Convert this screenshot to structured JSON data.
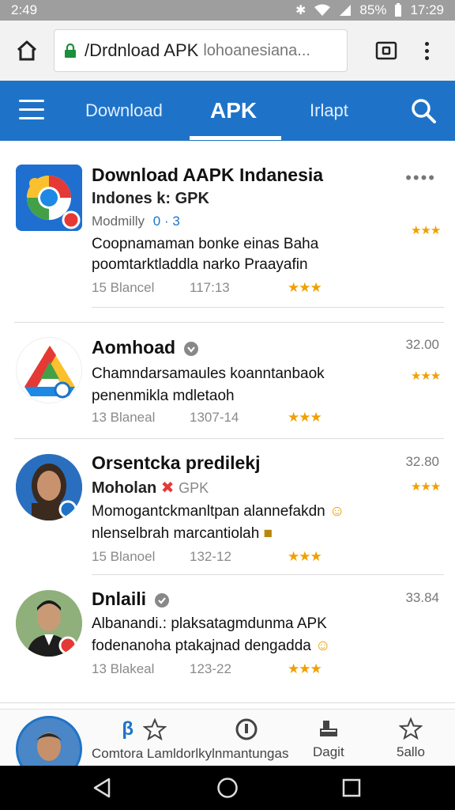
{
  "status_bar": {
    "time_left": "2:49",
    "battery": "85%",
    "time_right": "17:29"
  },
  "browser": {
    "url_main": "/Drdnload APK",
    "url_rest": "lohoanesiana...",
    "home_icon": "home-icon",
    "lock_icon": "lock-icon",
    "tabs_icon": "tabs-icon",
    "menu_icon": "overflow-menu-icon"
  },
  "nav": {
    "tabs": [
      "Download",
      "APK",
      "Irlapt"
    ],
    "active_tab": "APK",
    "menu_icon": "hamburger-icon",
    "search_icon": "search-icon",
    "color": "#1e73c8"
  },
  "items": [
    {
      "title": "Download AAPK Indanesia",
      "sub": "Indones k: GPK",
      "sub2": "Modmilly",
      "sub2_extra": "0 · 3",
      "desc1": "Coopnamaman bonke einas Baha",
      "desc2": "poomtarktladdla narko Praayafin",
      "meta_label": "15 Blancel",
      "meta_num": "117:13",
      "more": "••••"
    },
    {
      "title": "Aomhoad",
      "price": "32.00",
      "desc1": "Chamndarsamaules koanntanbaok",
      "desc2": "penenmikla mdletaoh",
      "meta_label": "13 Blaneal",
      "meta_num": "1307-14"
    },
    {
      "title": "Orsentcka predilekj",
      "sub": "Moholan",
      "sub_extra": "GPK",
      "price": "32.80",
      "desc1": "Momogantckmanltpan alannefakdn",
      "desc2": "nlenselbrah marcantiolah",
      "meta_label": "15 Blanoel",
      "meta_num": "132-12"
    },
    {
      "title": "Dnlaili",
      "price": "33.84",
      "desc1": "Albanandi.: plaksatagmdunma APK",
      "desc2": "fodenanoha ptakajnad dengadda",
      "meta_label": "13 Blakeal",
      "meta_num": "123-22"
    }
  ],
  "bottom_nav": {
    "items": [
      {
        "label": "Comtora Lamldorlkylnmantungas",
        "icon": "star-icon"
      },
      {
        "label": "Dagit",
        "icon": "upload-icon"
      },
      {
        "label": "5allo",
        "icon": "star-icon"
      }
    ]
  },
  "system_nav": {
    "back_icon": "back-icon",
    "home_icon": "circle-home-icon",
    "recents_icon": "recents-icon"
  }
}
